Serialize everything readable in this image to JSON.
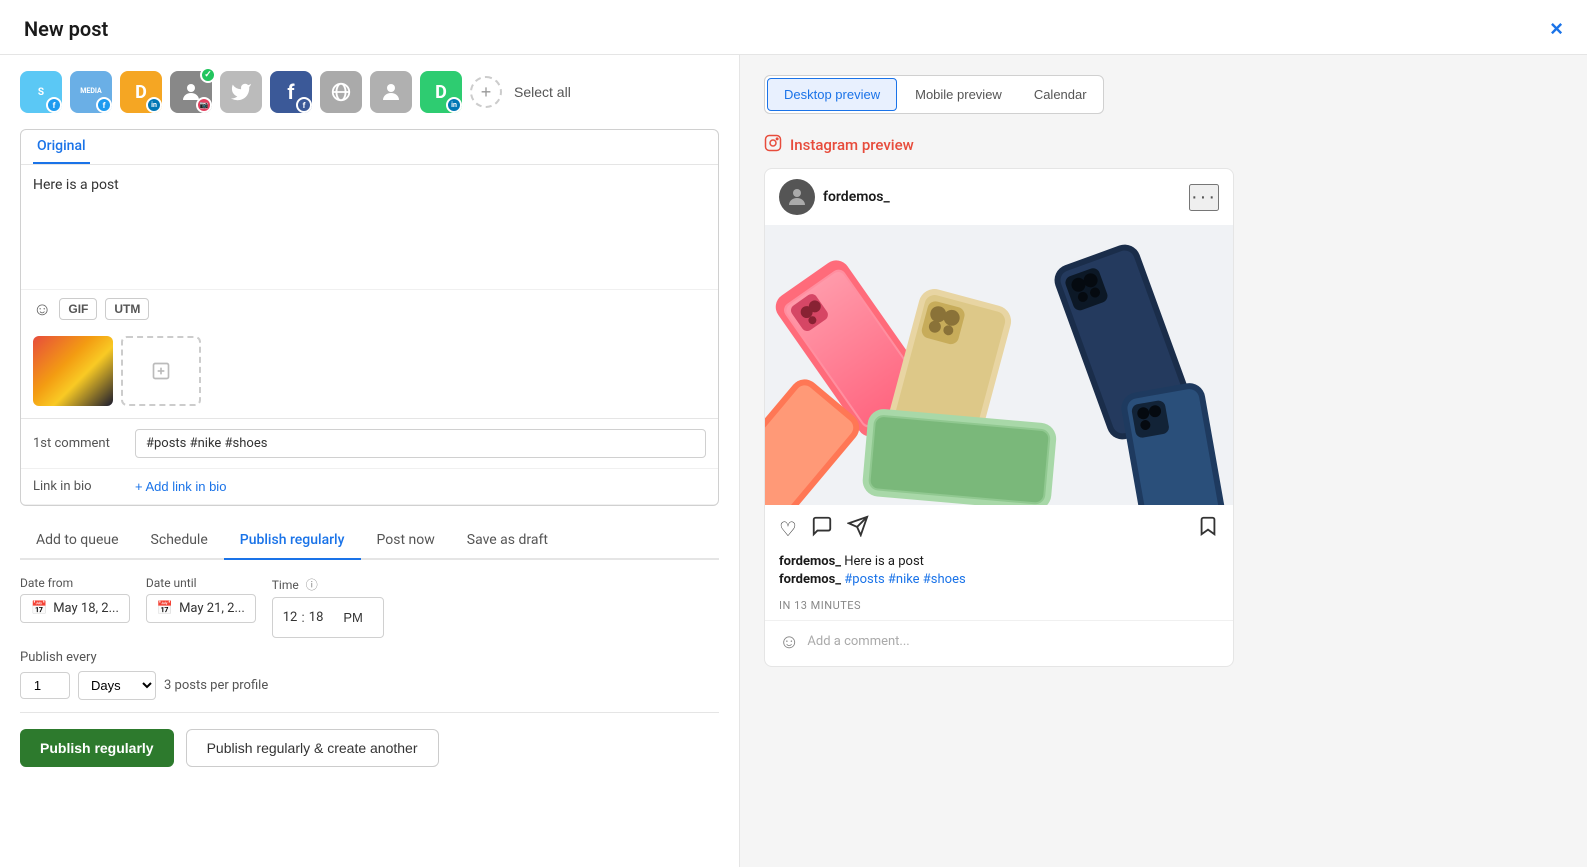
{
  "modal": {
    "title": "New post",
    "close_icon": "×"
  },
  "social_icons": [
    {
      "id": "icon1",
      "color": "#5bc8f5",
      "label": "S",
      "network": "twitter-variant",
      "bg": "#5bc8f5"
    },
    {
      "id": "icon2",
      "color": "#4a90d9",
      "label": "MEDIA",
      "network": "media",
      "bg": "#6aafe6",
      "sub": "f"
    },
    {
      "id": "icon3",
      "color": "#f5a623",
      "label": "D",
      "network": "linkedin-variant",
      "bg": "#f5a623",
      "sub": "in"
    },
    {
      "id": "icon4",
      "color": "#e4405f",
      "label": "person",
      "network": "instagram",
      "bg": "#555",
      "checked": true
    },
    {
      "id": "icon5",
      "color": "#ccc",
      "label": "bird",
      "network": "twitter",
      "bg": "#aaa"
    },
    {
      "id": "icon6",
      "color": "#e74c3c",
      "label": "F",
      "network": "facebook",
      "bg": "#3b5998"
    },
    {
      "id": "icon7",
      "color": "#dd4b39",
      "label": "map",
      "network": "google",
      "bg": "#aaa"
    },
    {
      "id": "icon8",
      "color": "#aaa",
      "label": "person2",
      "network": "profile",
      "bg": "#aaa"
    },
    {
      "id": "icon9",
      "color": "#2ecc71",
      "label": "D",
      "network": "linkedin2",
      "bg": "#2ecc71",
      "sub": "in"
    }
  ],
  "select_all": "Select all",
  "post": {
    "tab_label": "Original",
    "content": "Here is a post",
    "gif_btn": "GIF",
    "utm_btn": "UTM",
    "first_comment_label": "1st comment",
    "first_comment_value": "#posts #nike #shoes",
    "link_in_bio_label": "Link in bio",
    "link_in_bio_btn": "+ Add link in bio"
  },
  "tabs": [
    {
      "id": "add-to-queue",
      "label": "Add to queue"
    },
    {
      "id": "schedule",
      "label": "Schedule"
    },
    {
      "id": "publish-regularly",
      "label": "Publish regularly",
      "active": true
    },
    {
      "id": "post-now",
      "label": "Post now"
    },
    {
      "id": "save-as-draft",
      "label": "Save as draft"
    }
  ],
  "schedule": {
    "date_from_label": "Date from",
    "date_from_value": "May 18, 2...",
    "date_until_label": "Date until",
    "date_until_value": "May 21, 2...",
    "time_label": "Time",
    "time_hour": "12",
    "time_minute": "18",
    "time_ampm": "PM",
    "publish_every_label": "Publish every",
    "publish_every_number": "1",
    "publish_every_unit": "Days",
    "posts_info": "3 posts per profile"
  },
  "action_buttons": {
    "primary": "Publish regularly",
    "secondary": "Publish regularly & create another"
  },
  "preview": {
    "tabs": [
      "Desktop preview",
      "Mobile preview",
      "Calendar"
    ],
    "active_tab": "Desktop preview",
    "section_title": "Instagram preview",
    "instagram": {
      "username": "fordemos_",
      "caption_text": "Here is a post",
      "hashtags": "#posts #nike #shoes",
      "time": "IN 13 MINUTES",
      "comment_placeholder": "Add a comment..."
    }
  }
}
